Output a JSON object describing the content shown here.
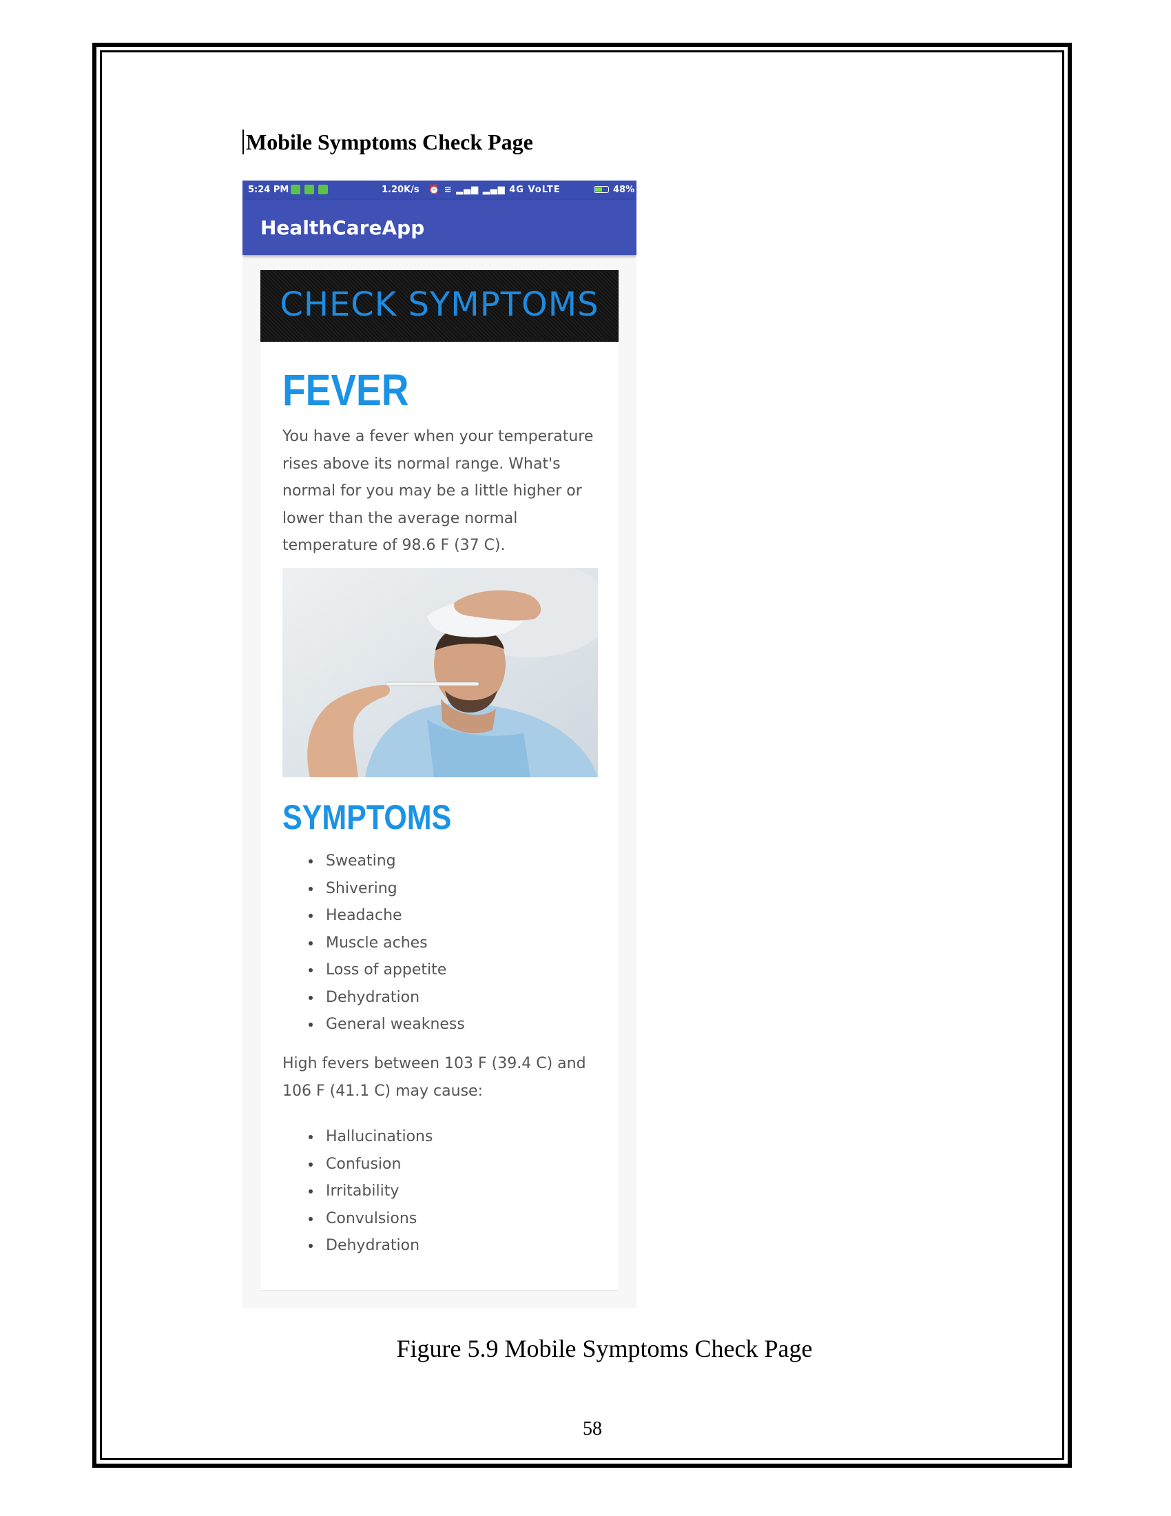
{
  "document": {
    "section_heading": "Mobile Symptoms Check Page",
    "figure_caption": "Figure 5.9 Mobile Symptoms Check Page",
    "page_number": "58"
  },
  "phone": {
    "status_bar": {
      "time": "5:24 PM",
      "speed": "1.20K/s",
      "network": "4G VoLTE",
      "battery": "48%",
      "battery_level": 0.48
    },
    "app_bar": {
      "title": "HealthCareApp",
      "color": "#3f51b5"
    },
    "content": {
      "banner": "CHECK SYMPTOMS",
      "heading": "FEVER",
      "intro_lines": [
        "You have a fever when your temperature",
        "rises above its normal range. What's",
        "normal for you may be a little higher or",
        "lower than the average normal",
        "temperature of 98.6 F (37 C)."
      ],
      "symptoms_heading": "SYMPTOMS",
      "symptoms": [
        "Sweating",
        "Shivering",
        "Headache",
        "Muscle aches",
        "Loss of appetite",
        "Dehydration",
        "General weakness"
      ],
      "high_fever_lines": [
        "High fevers between 103 F (39.4 C) and",
        "106 F (41.1 C) may cause:"
      ],
      "high_fever_effects": [
        "Hallucinations",
        "Confusion",
        "Irritability",
        "Convulsions",
        "Dehydration"
      ],
      "accent_color": "#1a93e6"
    }
  }
}
